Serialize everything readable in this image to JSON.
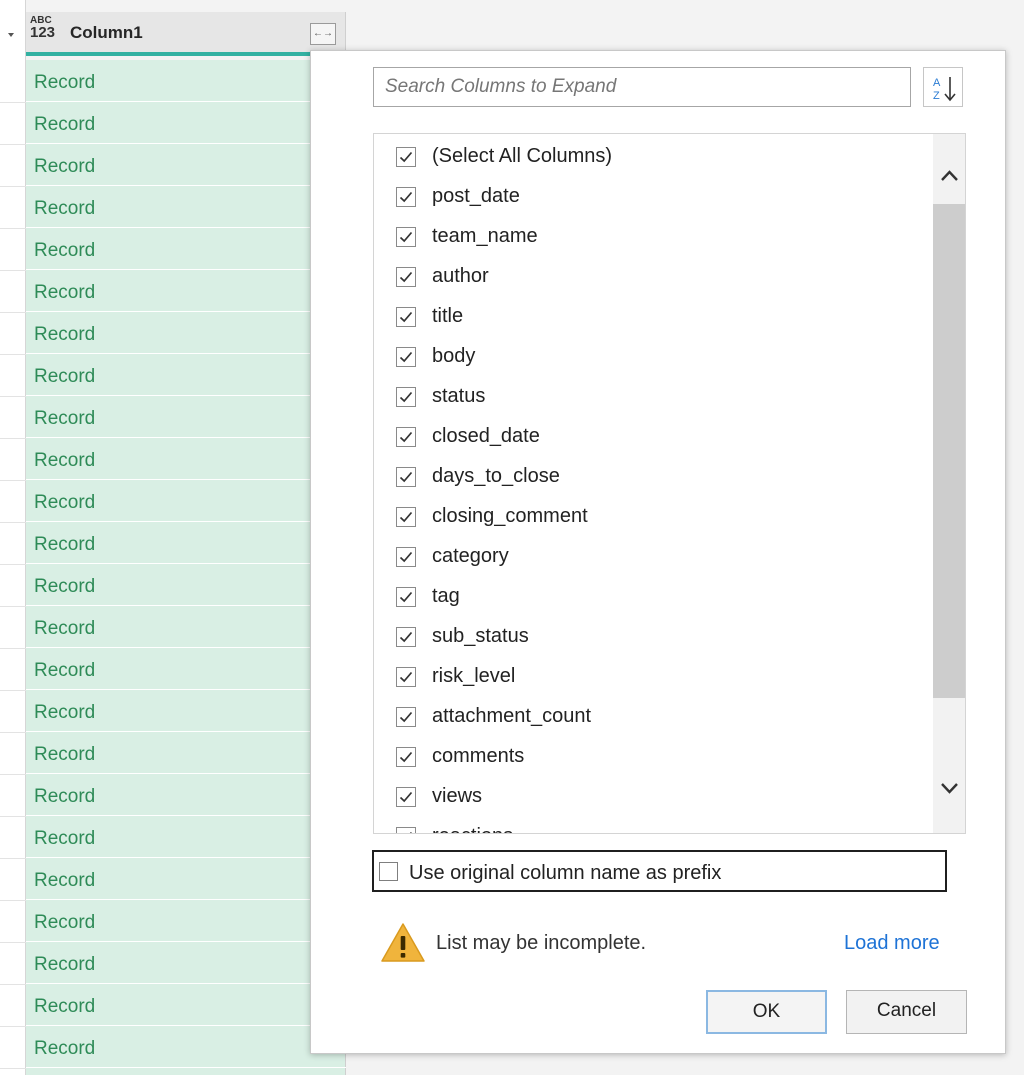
{
  "grid": {
    "column_type_top": "ABC",
    "column_type_bottom": "123",
    "column_title": "Column1",
    "row_value": "Record",
    "rows": [
      "Record",
      "Record",
      "Record",
      "Record",
      "Record",
      "Record",
      "Record",
      "Record",
      "Record",
      "Record",
      "Record",
      "Record",
      "Record",
      "Record",
      "Record",
      "Record",
      "Record",
      "Record",
      "Record",
      "Record",
      "Record",
      "Record",
      "Record",
      "Record"
    ]
  },
  "expand": {
    "search_placeholder": "Search Columns to Expand",
    "search_value": "",
    "columns": [
      {
        "label": "(Select All Columns)",
        "checked": true
      },
      {
        "label": "post_date",
        "checked": true
      },
      {
        "label": "team_name",
        "checked": true
      },
      {
        "label": "author",
        "checked": true
      },
      {
        "label": "title",
        "checked": true
      },
      {
        "label": "body",
        "checked": true
      },
      {
        "label": "status",
        "checked": true
      },
      {
        "label": "closed_date",
        "checked": true
      },
      {
        "label": "days_to_close",
        "checked": true
      },
      {
        "label": "closing_comment",
        "checked": true
      },
      {
        "label": "category",
        "checked": true
      },
      {
        "label": "tag",
        "checked": true
      },
      {
        "label": "sub_status",
        "checked": true
      },
      {
        "label": "risk_level",
        "checked": true
      },
      {
        "label": "attachment_count",
        "checked": true
      },
      {
        "label": "comments",
        "checked": true
      },
      {
        "label": "views",
        "checked": true
      },
      {
        "label": "reactions",
        "checked": true
      }
    ],
    "prefix_label": "Use original column name as prefix",
    "prefix_checked": false,
    "warning_text": "List may be incomplete.",
    "load_more": "Load more",
    "ok_label": "OK",
    "cancel_label": "Cancel"
  },
  "colors": {
    "accent": "#33b1a2",
    "row_bg": "#d9efe4",
    "row_text": "#2e8b57",
    "link": "#1e73d6",
    "warning": "#f0b43c"
  }
}
